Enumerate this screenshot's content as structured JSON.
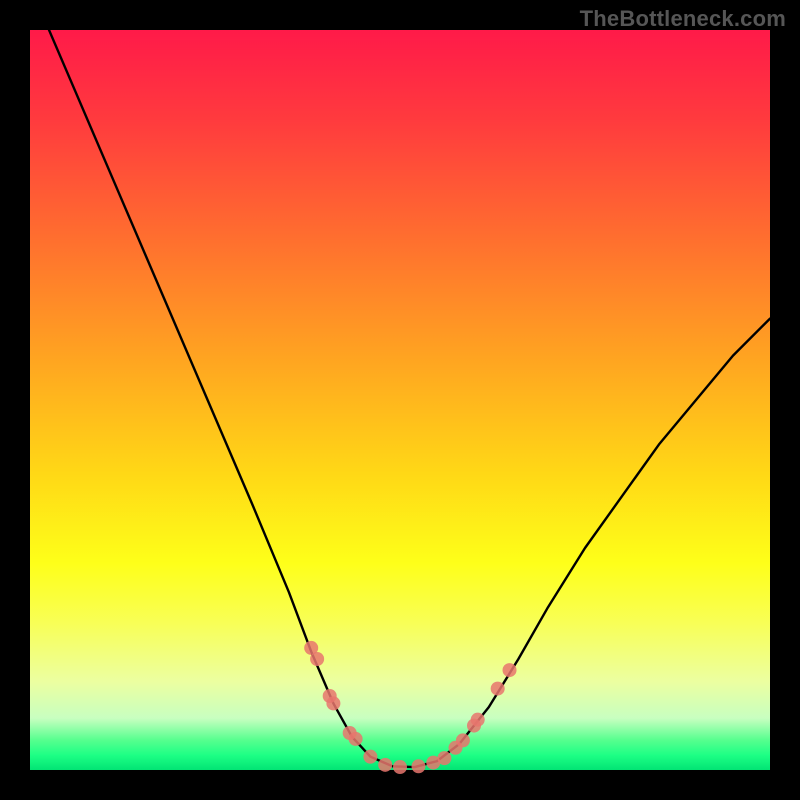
{
  "watermark": "TheBottleneck.com",
  "chart_data": {
    "type": "line",
    "title": "",
    "xlabel": "",
    "ylabel": "",
    "xlim": [
      0,
      100
    ],
    "ylim": [
      0,
      100
    ],
    "grid": false,
    "legend": false,
    "series": [
      {
        "name": "curve",
        "color": "#000000",
        "x": [
          0,
          6,
          12,
          18,
          24,
          30,
          35,
          38,
          41,
          43.5,
          46,
          49,
          52,
          55,
          58,
          62,
          66,
          70,
          75,
          80,
          85,
          90,
          95,
          100
        ],
        "y": [
          106,
          92,
          78,
          64,
          50,
          36,
          24,
          16,
          9,
          4.5,
          1.8,
          0.5,
          0.4,
          1.2,
          3.5,
          8.5,
          15,
          22,
          30,
          37,
          44,
          50,
          56,
          61
        ]
      },
      {
        "name": "markers",
        "color": "#e8766d",
        "type": "scatter",
        "x": [
          38.0,
          38.8,
          40.5,
          41.0,
          43.2,
          44.0,
          46.0,
          48.0,
          50.0,
          52.5,
          54.5,
          56.0,
          57.5,
          58.5,
          60.0,
          60.5,
          63.2,
          64.8
        ],
        "y": [
          16.5,
          15.0,
          10.0,
          9.0,
          5.0,
          4.2,
          1.8,
          0.7,
          0.4,
          0.5,
          1.0,
          1.6,
          3.0,
          4.0,
          6.0,
          6.8,
          11.0,
          13.5
        ]
      }
    ],
    "background_gradient": {
      "stops": [
        {
          "pos": 0.0,
          "color": "#ff1a49"
        },
        {
          "pos": 0.12,
          "color": "#ff3a3e"
        },
        {
          "pos": 0.28,
          "color": "#ff6e2f"
        },
        {
          "pos": 0.44,
          "color": "#ffa321"
        },
        {
          "pos": 0.6,
          "color": "#ffd816"
        },
        {
          "pos": 0.72,
          "color": "#feff19"
        },
        {
          "pos": 0.8,
          "color": "#f8ff55"
        },
        {
          "pos": 0.88,
          "color": "#ecffa0"
        },
        {
          "pos": 0.93,
          "color": "#c8ffc0"
        },
        {
          "pos": 0.96,
          "color": "#55ff8e"
        },
        {
          "pos": 0.98,
          "color": "#1dff85"
        },
        {
          "pos": 1.0,
          "color": "#02e474"
        }
      ]
    }
  }
}
